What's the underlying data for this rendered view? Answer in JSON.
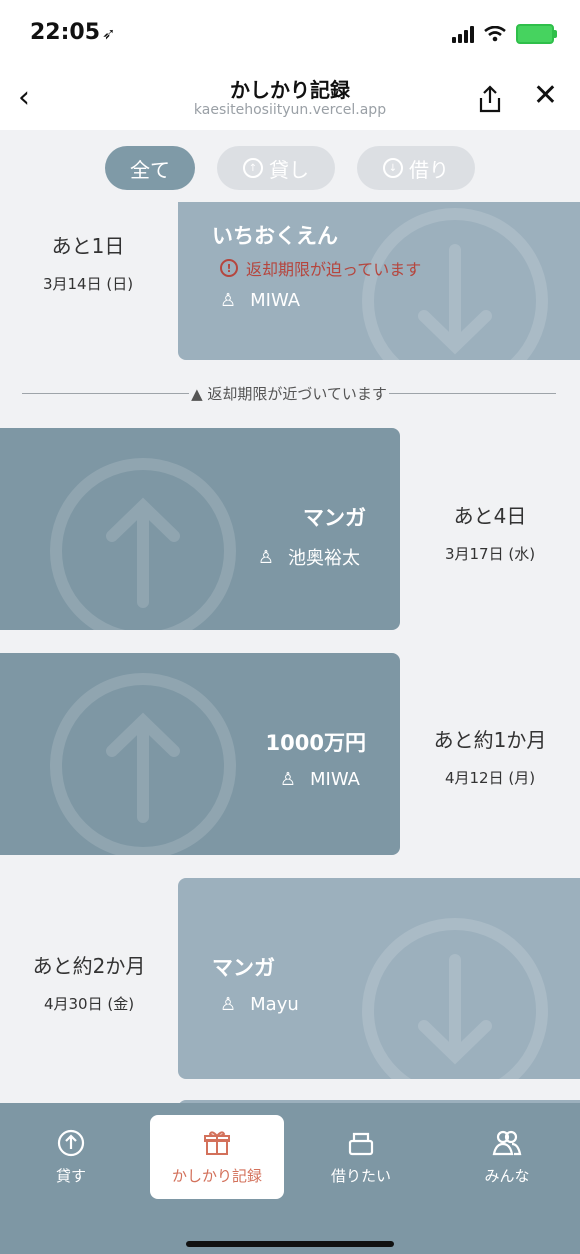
{
  "status": {
    "time": "22:05"
  },
  "header": {
    "title": "かしかり記録",
    "url": "kaesitehosiityun.vercel.app"
  },
  "filters": {
    "all": "全て",
    "lend": "貸し",
    "borrow": "借り"
  },
  "divider": "▲ 返却期限が近づいています",
  "items": [
    {
      "type": "borrow",
      "name": "いちおくえん",
      "warning": "返却期限が迫っています",
      "person": "MIWA",
      "remaining": "あと1日",
      "date": "3月14日 (日)"
    },
    {
      "type": "lend",
      "name": "マンガ",
      "person": "池奥裕太",
      "remaining": "あと4日",
      "date": "3月17日 (水)"
    },
    {
      "type": "lend",
      "name": "1000万円",
      "person": "MIWA",
      "remaining": "あと約1か月",
      "date": "4月12日 (月)"
    },
    {
      "type": "borrow",
      "name": "マンガ",
      "person": "Mayu",
      "remaining": "あと約2か月",
      "date": "4月30日 (金)"
    }
  ],
  "tabs": [
    {
      "label": "貸す",
      "icon": "arrow-up-circle-icon"
    },
    {
      "label": "かしかり記録",
      "icon": "gift-icon",
      "selected": true
    },
    {
      "label": "借りたい",
      "icon": "box-icon"
    },
    {
      "label": "みんな",
      "icon": "users-icon"
    }
  ],
  "colors": {
    "lend_card": "#7e97a4",
    "borrow_card": "#9cb0bd",
    "accent": "#d3715b",
    "warning": "#b5463e"
  }
}
